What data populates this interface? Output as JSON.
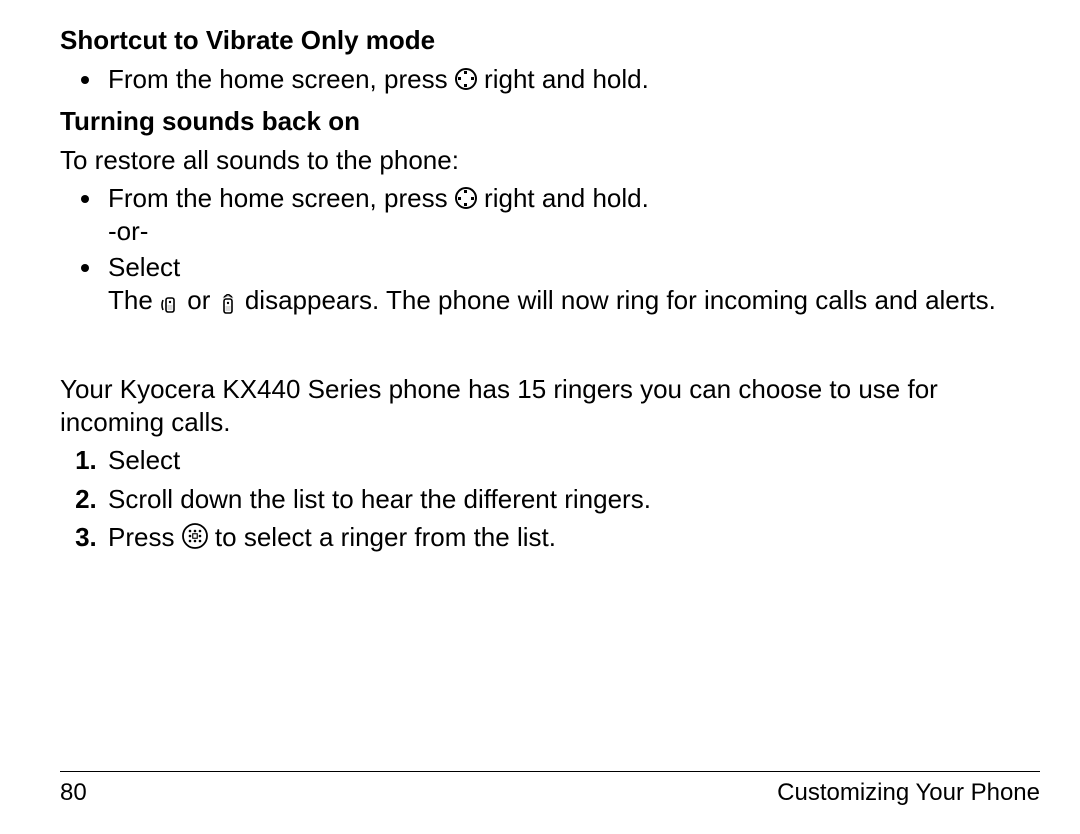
{
  "section1": {
    "heading": "Shortcut to Vibrate Only mode",
    "bullet1_pre": "From the home screen, press ",
    "bullet1_post": " right and hold."
  },
  "section2": {
    "heading": "Turning sounds back on",
    "intro": "To restore all sounds to the phone:",
    "bullet1_pre": "From the home screen, press ",
    "bullet1_post": " right and hold.",
    "or_line": "-or-",
    "bullet2": "Select",
    "result_pre": "The ",
    "result_mid": " or ",
    "result_post": " disappears. The phone will now ring for incoming calls and alerts."
  },
  "section3": {
    "intro": "Your Kyocera KX440 Series phone has 15 ringers you can choose to use for incoming calls.",
    "step1": "Select",
    "step2": "Scroll down the list to hear the different ringers.",
    "step3_pre": "Press ",
    "step3_post": " to select a ringer from the list."
  },
  "footer": {
    "page_number": "80",
    "section_title": "Customizing Your Phone"
  },
  "icons": {
    "nav": "navigation-circle-icon",
    "vibrate": "vibrate-phone-icon",
    "silence": "silence-phone-icon",
    "ok": "ok-button-icon"
  }
}
